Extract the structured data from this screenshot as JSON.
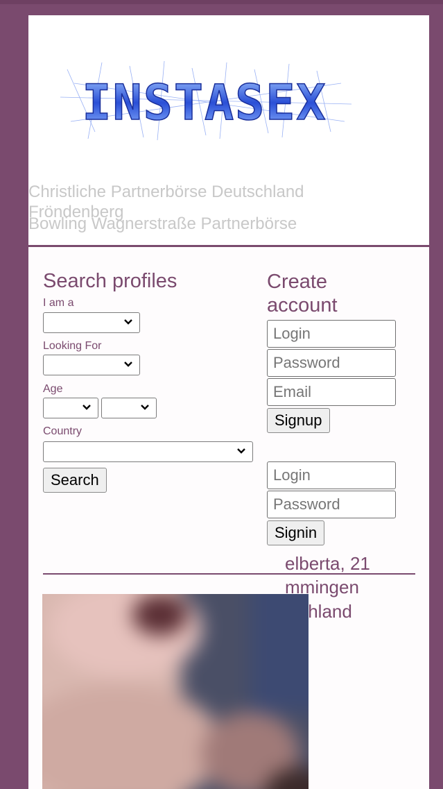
{
  "header": {
    "logo_text": "INSTASEX",
    "tagline_1": "Christliche Partnerbörse Deutschland",
    "tagline_2": "Fröndenberg",
    "tagline_3": "Bowling Wagnerstraße Partnerbörse"
  },
  "search": {
    "title": "Search profiles",
    "iam_label": "I am a",
    "looking_label": "Looking For",
    "age_label": "Age",
    "country_label": "Country",
    "search_button": "Search"
  },
  "signup": {
    "title": "Create account",
    "login_placeholder": "Login",
    "password_placeholder": "Password",
    "email_placeholder": "Email",
    "signup_button": "Signup"
  },
  "signin": {
    "login_placeholder": "Login",
    "password_placeholder": "Password",
    "signin_button": "Signin"
  },
  "profile": {
    "name_age": "elberta, 21",
    "city": "mmingen",
    "country": "tschland"
  },
  "colors": {
    "accent": "#7a4a6e",
    "background": "#7a4a6e"
  },
  "icons": [
    "chevron-down-icon"
  ]
}
